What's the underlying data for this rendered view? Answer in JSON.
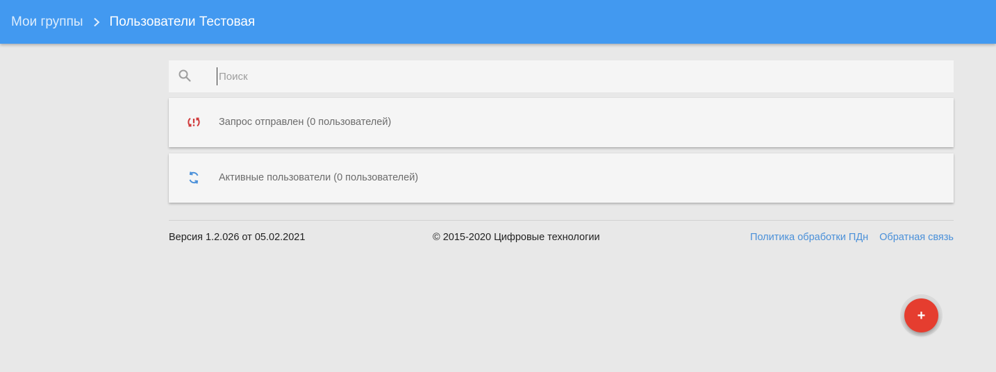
{
  "header": {
    "breadcrumb_root": "Мои группы",
    "breadcrumb_current": "Пользователи Тестовая",
    "separator_icon": "chevron-right-icon",
    "background": "#4299f0"
  },
  "search": {
    "placeholder": "Поиск",
    "value": "",
    "icon": "search-icon"
  },
  "panels": [
    {
      "icon": "sync-problem-icon",
      "icon_color": "#d0393a",
      "label": "Запрос отправлен (0 пользователей)"
    },
    {
      "icon": "sync-icon",
      "icon_color": "#4a90d9",
      "label": "Активные пользователи (0 пользователей)"
    }
  ],
  "footer": {
    "version": "Версия 1.2.026 от 05.02.2021",
    "copyright": "© 2015-2020 Цифровые технологии",
    "link_privacy": "Политика обработки ПДн",
    "link_feedback": "Обратная связь"
  },
  "fab": {
    "label": "+",
    "icon": "add-icon",
    "color": "#e53d2f"
  }
}
